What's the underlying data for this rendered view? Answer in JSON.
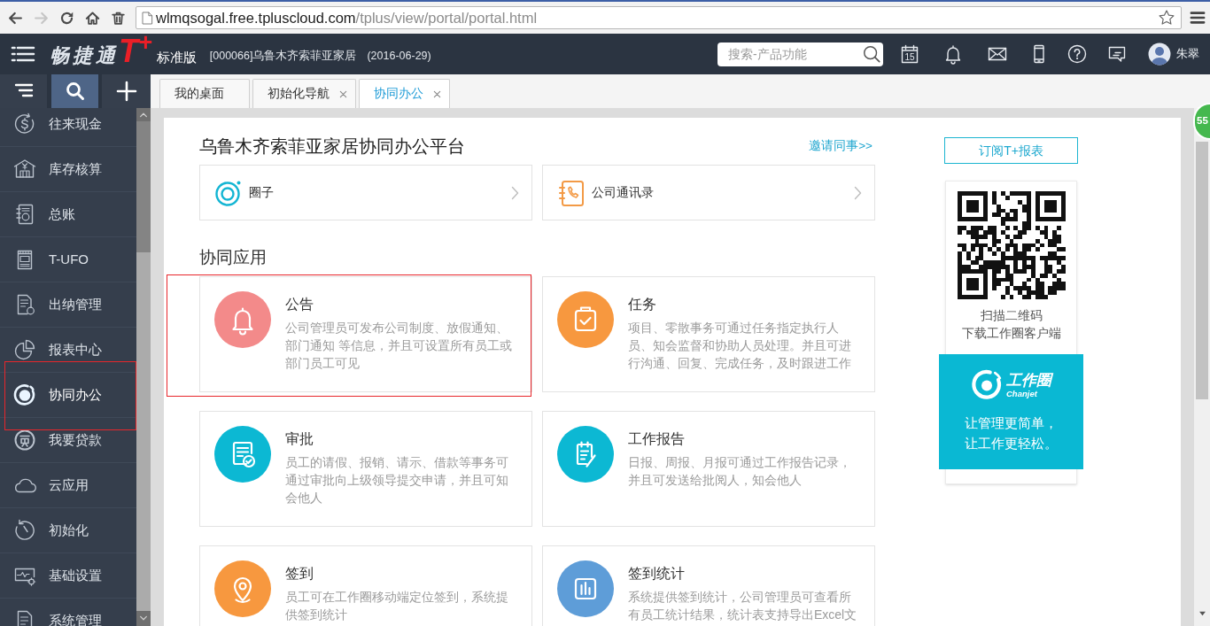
{
  "browser": {
    "nav_buttons": [
      {
        "kind": "back",
        "disabled": false
      },
      {
        "kind": "forward",
        "disabled": true
      },
      {
        "kind": "reload",
        "disabled": false
      },
      {
        "kind": "home",
        "disabled": false
      },
      {
        "kind": "trash",
        "disabled": false
      }
    ],
    "address": {
      "host": "wlmqsogal.free.tpluscloud.com",
      "path": "/tplus/view/portal/portal.html"
    },
    "bookmarked": false
  },
  "header": {
    "logo": {
      "name": "畅捷通",
      "mark": "T$^{+}$",
      "edition": "标准版"
    },
    "company": "[000066]乌鲁木齐索菲亚家居",
    "date": "(2016-06-29)",
    "search": {
      "placeholder": "搜索-产品功能"
    },
    "icons": [
      {
        "kind": "calendar",
        "label": "15"
      },
      {
        "kind": "bell"
      },
      {
        "kind": "mail"
      },
      {
        "kind": "phone"
      },
      {
        "kind": "help"
      },
      {
        "kind": "chat"
      }
    ],
    "user": {
      "name": "朱翠"
    }
  },
  "sidebar": {
    "tools": [
      {
        "kind": "list",
        "selected": false
      },
      {
        "kind": "search",
        "selected": true
      },
      {
        "kind": "add",
        "selected": false
      }
    ],
    "items": [
      {
        "label": "往来现金",
        "selected": false,
        "highlighted": false
      },
      {
        "label": "库存核算",
        "selected": false,
        "highlighted": false
      },
      {
        "label": "总账",
        "selected": false,
        "highlighted": false
      },
      {
        "label": "T-UFO",
        "selected": false,
        "highlighted": false
      },
      {
        "label": "出纳管理",
        "selected": false,
        "highlighted": false
      },
      {
        "label": "报表中心",
        "selected": false,
        "highlighted": false
      },
      {
        "label": "协同办公",
        "selected": true,
        "highlighted": true
      },
      {
        "label": "我要贷款",
        "selected": false,
        "highlighted": false
      },
      {
        "label": "云应用",
        "selected": false,
        "highlighted": false
      },
      {
        "label": "初始化",
        "selected": false,
        "highlighted": false
      },
      {
        "label": "基础设置",
        "selected": false,
        "highlighted": false
      },
      {
        "label": "系统管理",
        "selected": false,
        "highlighted": false
      }
    ]
  },
  "tabs": [
    {
      "label": "我的桌面",
      "selected": false,
      "closable": false
    },
    {
      "label": "初始化导航",
      "selected": false,
      "closable": true
    },
    {
      "label": "协同办公",
      "selected": true,
      "closable": true
    }
  ],
  "portal": {
    "title": "乌鲁木齐索菲亚家居协同办公平台",
    "invite_link": "邀请同事>>",
    "quick_links": [
      {
        "label": "圈子"
      },
      {
        "label": "公司通讯录"
      }
    ],
    "section_title": "协同应用",
    "apps": [
      {
        "title": "公告",
        "description": "公司管理员可发布公司制度、放假通知、部门通知 等信息，并且可设置所有员工或部门员工可见",
        "color": "#f38a8a",
        "highlighted": true
      },
      {
        "title": "任务",
        "description": "项目、零散事务可通过任务指定执行人员、知会监督和协助人员处理。并且可进行沟通、回复、完成任务，及时跟进工作",
        "color": "#f7983f",
        "highlighted": false
      },
      {
        "title": "审批",
        "description": "员工的请假、报销、请示、借款等事务可通过审批向上级领导提交申请，并且可知会他人",
        "color": "#0cb8d3",
        "highlighted": false
      },
      {
        "title": "工作报告",
        "description": "日报、周报、月报可通过工作报告记录，并且可发送给批阅人，知会他人",
        "color": "#0cb8d3",
        "highlighted": false
      },
      {
        "title": "签到",
        "description": "员工可在工作圈移动端定位签到，系统提供签到统计",
        "color": "#f7983f",
        "highlighted": false
      },
      {
        "title": "签到统计",
        "description": "系统提供签到统计，公司管理员可查看所有员工统计结果，统计表支持导出Excel文",
        "color": "#5e9dd8",
        "highlighted": false
      }
    ]
  },
  "side_panel": {
    "subscribe_button": "订阅T+报表",
    "qr_caption": [
      "扫描二维码",
      "下载工作圈客户端"
    ],
    "banner": {
      "logo_name": "工作圈",
      "logo_sub": "Chanjet",
      "slogan": [
        "让管理更简单，",
        "让工作更轻松。"
      ]
    }
  },
  "badge": {
    "count": "55"
  }
}
